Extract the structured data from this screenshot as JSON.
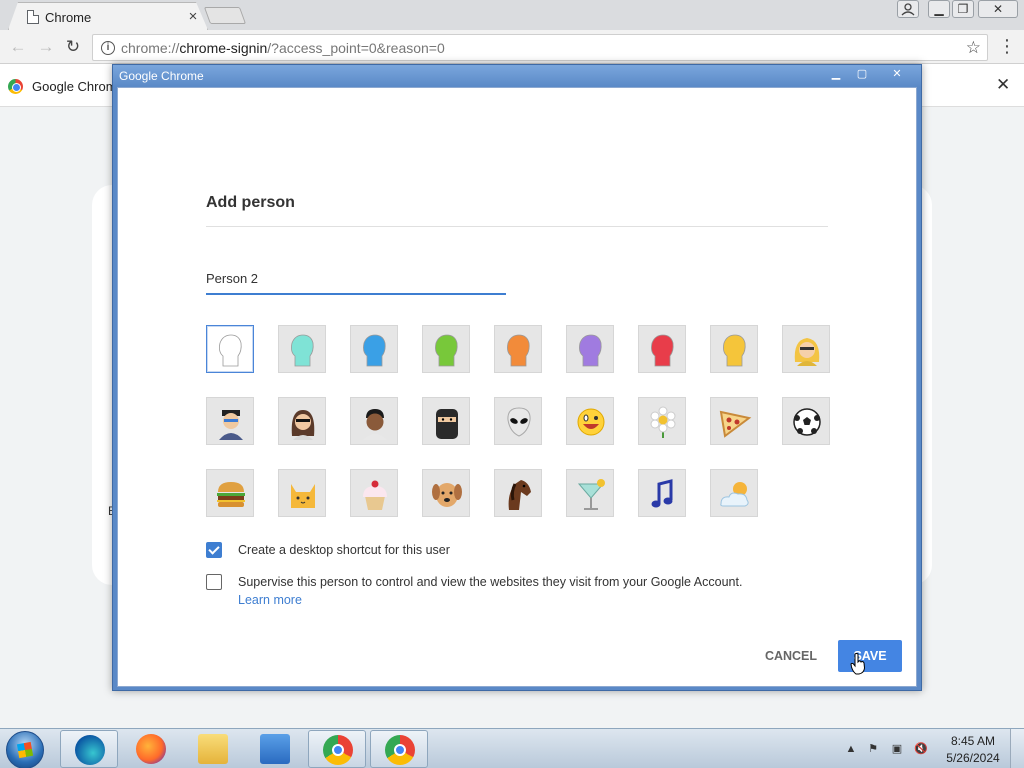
{
  "browser": {
    "tab_title": "Chrome",
    "tab_close": "×",
    "url_scheme": "chrome://",
    "url_host": "chrome-signin",
    "url_path": "/?access_point=0&reason=0",
    "infobar_text": "Google Chrom",
    "infobar_close": "✕",
    "page_partial_text": "E"
  },
  "dialog": {
    "title": "Google Chrome",
    "heading": "Add person",
    "name_value": "Person 2",
    "avatars": [
      {
        "name": "generic-white",
        "selected": true
      },
      {
        "name": "generic-teal"
      },
      {
        "name": "generic-blue"
      },
      {
        "name": "generic-green"
      },
      {
        "name": "generic-orange"
      },
      {
        "name": "generic-purple"
      },
      {
        "name": "generic-red"
      },
      {
        "name": "generic-yellow"
      },
      {
        "name": "blonde-woman"
      },
      {
        "name": "businessman"
      },
      {
        "name": "woman-sunglasses"
      },
      {
        "name": "man"
      },
      {
        "name": "ninja"
      },
      {
        "name": "alien"
      },
      {
        "name": "smiley"
      },
      {
        "name": "flower"
      },
      {
        "name": "pizza"
      },
      {
        "name": "soccer-ball"
      },
      {
        "name": "burger"
      },
      {
        "name": "cat"
      },
      {
        "name": "cupcake"
      },
      {
        "name": "dog"
      },
      {
        "name": "horse"
      },
      {
        "name": "cocktail"
      },
      {
        "name": "music-note"
      },
      {
        "name": "sun-cloud"
      }
    ],
    "shortcut_label": "Create a desktop shortcut for this user",
    "shortcut_checked": true,
    "supervise_label": "Supervise this person to control and view the websites they visit from your Google Account.",
    "supervise_checked": false,
    "learn_more": "Learn more",
    "cancel_label": "CANCEL",
    "save_label": "SAVE"
  },
  "taskbar": {
    "apps": [
      "edge-icon",
      "firefox-icon",
      "file-explorer-icon",
      "media-player-icon",
      "chrome-icon",
      "chrome-icon"
    ],
    "time": "8:45 AM",
    "date": "5/26/2024"
  },
  "colors": {
    "accent": "#3e7ed1",
    "save_button": "#4485e3",
    "dialog_frame": "#5a89c7"
  }
}
